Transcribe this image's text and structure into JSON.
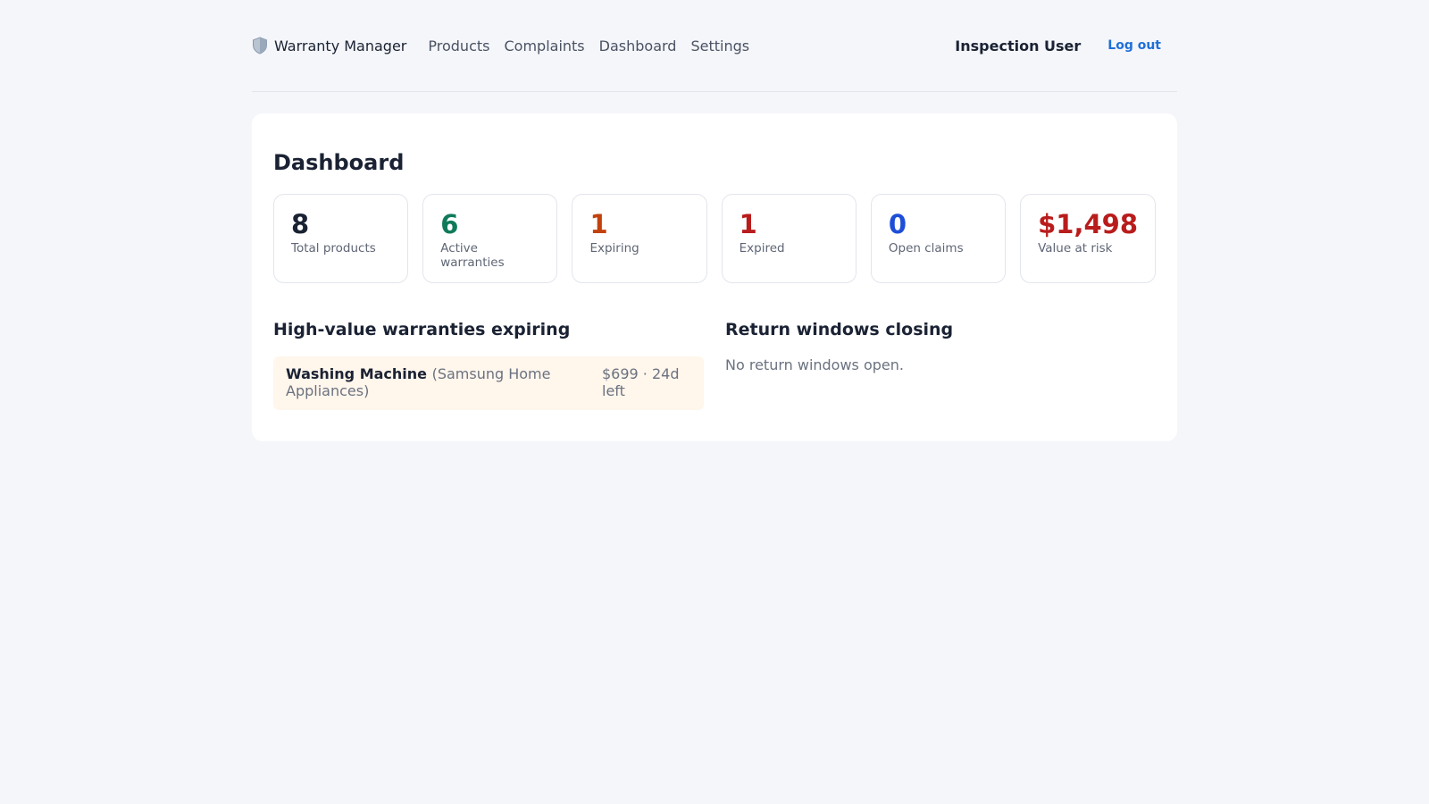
{
  "nav": {
    "brand": "Warranty Manager",
    "brand_icon": "shield-icon",
    "links": [
      "Products",
      "Complaints",
      "Dashboard",
      "Settings"
    ],
    "user": "Inspection User",
    "logout": "Log out"
  },
  "page": {
    "title": "Dashboard"
  },
  "stats": [
    {
      "value": "8",
      "label": "Total products",
      "color": "#1a2233"
    },
    {
      "value": "6",
      "label": "Active warranties",
      "color": "#0f7a5a"
    },
    {
      "value": "1",
      "label": "Expiring",
      "color": "#c2410c"
    },
    {
      "value": "1",
      "label": "Expired",
      "color": "#b91c1c"
    },
    {
      "value": "0",
      "label": "Open claims",
      "color": "#1d4ed8"
    },
    {
      "value": "$1,498",
      "label": "Value at risk",
      "color": "#b91c1c"
    }
  ],
  "expiring": {
    "title": "High-value warranties expiring",
    "items": [
      {
        "name": "Washing Machine",
        "brand": "(Samsung Home Appliances)",
        "detail": "$699 · 24d left"
      }
    ]
  },
  "returns": {
    "title": "Return windows closing",
    "empty": "No return windows open."
  }
}
